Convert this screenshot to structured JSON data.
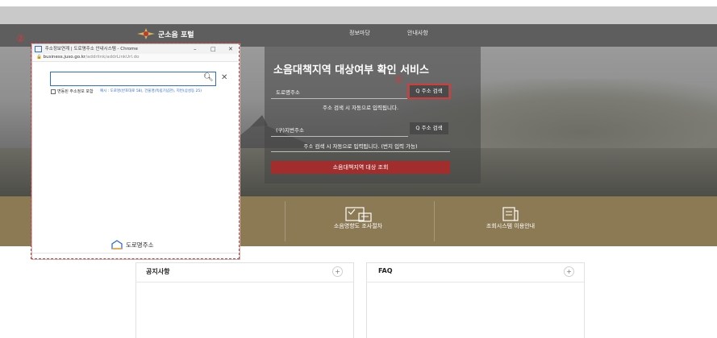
{
  "header": {
    "logo_text": "군소음 포털",
    "nav": [
      "정보마당",
      "안내사항"
    ]
  },
  "service": {
    "title": "소음대책지역 대상여부 확인 서비스",
    "road_label": "도로명주소",
    "road_search": "Q 주소 검색",
    "road_hint": "주소 검색 시 자동으로 입력됩니다.",
    "jibun_label": "(구)지번주소",
    "jibun_search": "Q 주소 검색",
    "jibun_hint": "주소 검색 시 자동으로 입력됩니다. (번지 입력 가능)",
    "submit": "소음대책지역 대상 조회"
  },
  "markers": {
    "one": "①",
    "two": "②"
  },
  "band": {
    "items": [
      {
        "label": "소음영향도 조사절차",
        "icon": "checklist-icon"
      },
      {
        "label": "조회시스템 이용안내",
        "icon": "guide-doc-icon"
      }
    ]
  },
  "cards": [
    {
      "title": "공지사항",
      "plus": "+"
    },
    {
      "title": "FAQ",
      "plus": "+"
    }
  ],
  "popup": {
    "window_title": "주소정보연계 | 도로명주소 안내시스템 - Chrome",
    "url_domain": "business.juso.go.kr",
    "url_path": "/addrlink/addrLinkUrl.do",
    "search_value": "",
    "search_placeholder": "",
    "checkbox_label": "변동된 주소정보 포함",
    "example_text": "예시 : 도로명(반포대로 58), 건물명(독립기념관), 지번(삼성동 25)",
    "footer_logo": "도로명주소",
    "controls": [
      "–",
      "□",
      "✕"
    ]
  },
  "colors": {
    "header_bg": "#5e5e5e",
    "accent_red": "#a12d2d",
    "highlight_red": "#d83a3a",
    "band_bg": "#8c7a55",
    "input_blue": "#2d6bd8"
  }
}
